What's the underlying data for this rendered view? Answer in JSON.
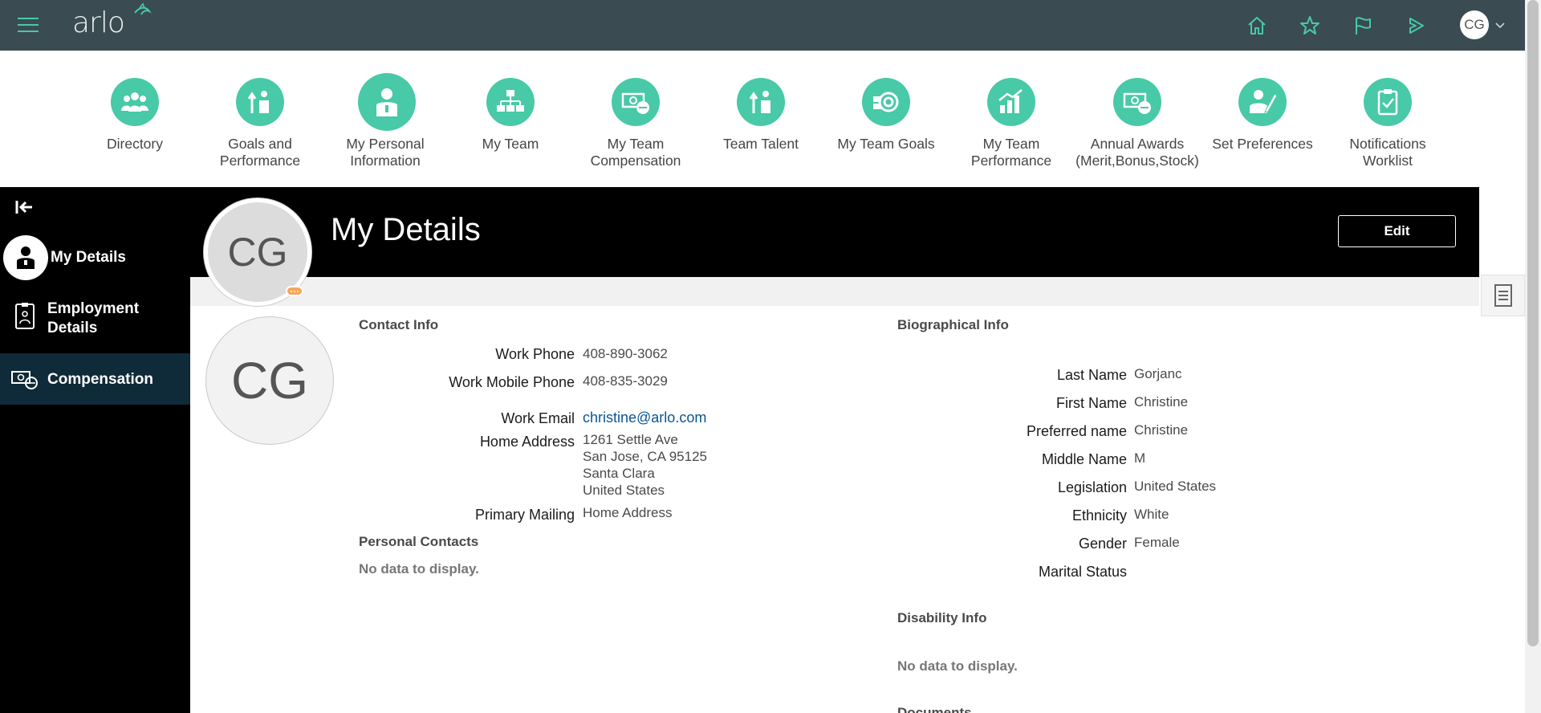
{
  "app": {
    "brand": "arlo",
    "user_initials": "CG",
    "colors": {
      "accent": "#48c9a7",
      "topbar": "#3a4b52",
      "sidebar": "#000000",
      "selected": "#0f2a39",
      "status": "#f7a65b"
    }
  },
  "topbar": {
    "icons": [
      "home-icon",
      "star-icon",
      "flag-icon",
      "play-icon"
    ]
  },
  "nav": {
    "items": [
      {
        "label": "Directory",
        "icon": "people-icon"
      },
      {
        "label": "Goals and\nPerformance",
        "icon": "goals-icon"
      },
      {
        "label": "My Personal\nInformation",
        "icon": "person-icon"
      },
      {
        "label": "My Team",
        "icon": "org-chart-icon"
      },
      {
        "label": "My Team\nCompensation",
        "icon": "money-icon"
      },
      {
        "label": "Team Talent",
        "icon": "talent-icon"
      },
      {
        "label": "My Team Goals",
        "icon": "target-icon"
      },
      {
        "label": "My Team\nPerformance",
        "icon": "bar-chart-icon"
      },
      {
        "label": "Annual Awards\n(Merit,Bonus,Stock)",
        "icon": "awards-icon"
      },
      {
        "label": "Set Preferences",
        "icon": "preferences-icon"
      },
      {
        "label": "Notifications\nWorklist",
        "icon": "clipboard-icon"
      }
    ]
  },
  "sidebar": {
    "items": [
      {
        "label": "My Details",
        "icon": "person-icon"
      },
      {
        "label": "Employment\nDetails",
        "icon": "badge-icon"
      },
      {
        "label": "Compensation",
        "icon": "money-icon"
      }
    ]
  },
  "header": {
    "title": "My Details",
    "edit_label": "Edit"
  },
  "contact": {
    "title": "Contact Info",
    "fields": [
      {
        "label": "Work Phone",
        "value": "408-890-3062"
      },
      {
        "label": "Work Mobile Phone",
        "value": "408-835-3029"
      },
      {
        "label": "Work Email",
        "value": "christine@arlo.com"
      },
      {
        "label": "Home Address",
        "value": "1261 Settle Ave\nSan Jose, CA 95125\nSanta Clara\nUnited States"
      },
      {
        "label": "Primary Mailing",
        "value": "Home Address"
      }
    ]
  },
  "personal_contacts": {
    "title": "Personal Contacts",
    "empty": "No data to display."
  },
  "bio": {
    "title": "Biographical Info",
    "fields": [
      {
        "label": "Last Name",
        "value": "Gorjanc"
      },
      {
        "label": "First Name",
        "value": "Christine"
      },
      {
        "label": "Preferred name",
        "value": "Christine"
      },
      {
        "label": "Middle Name",
        "value": "M"
      },
      {
        "label": "Legislation",
        "value": "United States"
      },
      {
        "label": "Ethnicity",
        "value": "White"
      },
      {
        "label": "Gender",
        "value": "Female"
      },
      {
        "label": "Marital Status",
        "value": ""
      }
    ]
  },
  "disability": {
    "title": "Disability Info",
    "empty": "No data to display."
  },
  "documents": {
    "title": "Documents"
  }
}
